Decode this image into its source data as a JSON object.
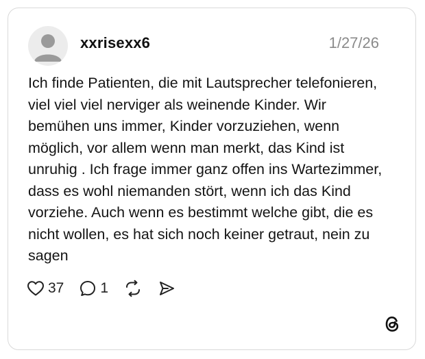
{
  "post": {
    "username": "xxrisexx6",
    "date": "1/27/26",
    "text": "Ich finde Patienten, die mit Lautsprecher telefonieren, viel viel viel nerviger als weinende Kinder. Wir bemühen uns immer, Kinder vorzuziehen, wenn möglich, vor allem wenn man merkt, das Kind ist unruhig . Ich frage immer ganz offen ins Wartezimmer, dass es wohl niemanden stört, wenn ich das Kind vorziehe. Auch wenn es bestimmt welche gibt, die es nicht wollen, es hat sich noch keiner getraut, nein zu sagen"
  },
  "actions": {
    "like_count": "37",
    "reply_count": "1"
  },
  "icons": {
    "avatar": "default-user-avatar",
    "like": "heart-icon",
    "reply": "speech-bubble-icon",
    "repost": "repost-icon",
    "share": "send-icon",
    "brand": "threads-logo-icon"
  },
  "colors": {
    "text": "#141414",
    "muted": "#8a8a8a",
    "border": "#d9d9d9",
    "avatar_bg": "#ececec",
    "avatar_fg": "#9a9a9a"
  }
}
